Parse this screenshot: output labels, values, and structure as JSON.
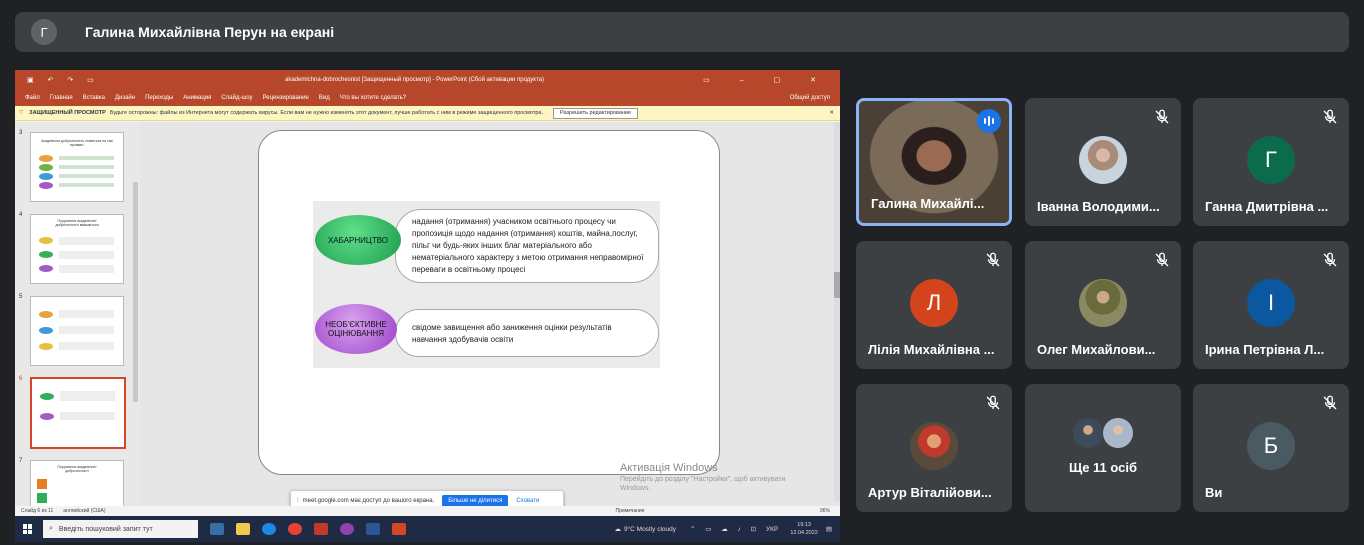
{
  "presenter_bar": {
    "initial": "Г",
    "title": "Галина Михайлівна Перун на екрані"
  },
  "powerpoint": {
    "window_title": "akademichna-dobrochesnist [Защищенный просмотр] - PowerPoint (Сбой активации продукта)",
    "menu": [
      "Файл",
      "Главная",
      "Вставка",
      "Дизайн",
      "Переходы",
      "Анимация",
      "Слайд-шоу",
      "Рецензирование",
      "Вид",
      "Что вы хотите сделать?"
    ],
    "share": "Общий доступ",
    "warning_title": "ЗАЩИЩЕННЫЙ ПРОСМОТР",
    "warning_text": "Будьте осторожны: файлы из Интернета могут содержать вирусы. Если вам не нужно изменять этот документ, лучше работать с ним в режиме защищенного просмотра.",
    "warning_button": "Разрешить редактирование",
    "thumb_numbers": [
      "3",
      "4",
      "5",
      "6",
      "7"
    ],
    "thumb3_title": "Академічна доброчесність ставиться на такі проявах:",
    "thumb4_title": "Порушення академічної доброчесності вважається",
    "thumb7_title": "Порушення академічної доброчесності",
    "slide": {
      "oval1": "ХАБАРНИЦТВО",
      "text1": "надання (отримання) учасником освітнього процесу чи пропозиція щодо надання (отримання) коштів, майна,послуг, пільг чи будь-яких інших благ матеріального або нематеріального характеру з метою отримання неправомірної переваги в освітньому процесі",
      "oval2": "НЕОБ'ЄКТИВНЕ ОЦІНЮВАННЯ",
      "text2": "свідоме завищення або заниження оцінки результатів навчання здобувачів освіти"
    },
    "activation_title": "Активація Windows",
    "activation_text": "Перейдіть до розділу \"Настройки\", щоб активувати Windows.",
    "share_notice": "meet.google.com має доступ до вашого екрана.",
    "stop_sharing": "Більше не ділитися",
    "hide": "Сховати",
    "status_left": "Слайд 6 из 11",
    "status_lang": "английский (США)",
    "status_notes": "Примечания",
    "status_zoom": "96%"
  },
  "taskbar": {
    "search_placeholder": "Введіть пошуковий запит тут",
    "weather": "9°C  Mostly cloudy",
    "lang": "УКР",
    "time": "19:13",
    "date": "12.04.2022"
  },
  "participants": [
    {
      "name": "Галина Михайлі...",
      "speaking": true
    },
    {
      "name": "Іванна Володими...",
      "muted": true
    },
    {
      "name": "Ганна Дмитрівна ...",
      "initial": "Г",
      "color": "#0b6b4a",
      "muted": true
    },
    {
      "name": "Лілія Михайлівна ...",
      "initial": "Л",
      "color": "#d4441c",
      "muted": true
    },
    {
      "name": "Олег Михайлови...",
      "muted": true
    },
    {
      "name": "Ірина Петрівна Л...",
      "initial": "І",
      "color": "#0b57a0",
      "muted": true
    },
    {
      "name": "Артур Віталійови...",
      "muted": true
    },
    {
      "name": "Ще 11 осіб"
    },
    {
      "name": "Ви",
      "initial": "Б",
      "color": "#4a5a62",
      "muted": true
    }
  ]
}
